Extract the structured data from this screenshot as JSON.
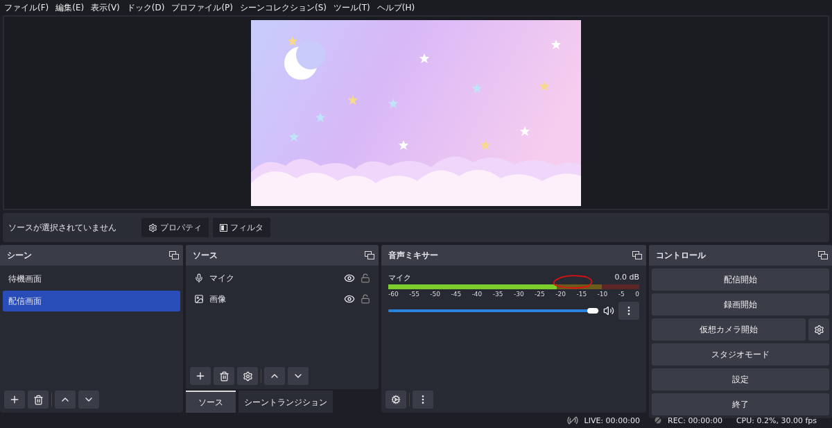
{
  "menu": [
    "ファイル(F)",
    "編集(E)",
    "表示(V)",
    "ドック(D)",
    "プロファイル(P)",
    "シーンコレクション(S)",
    "ツール(T)",
    "ヘルプ(H)"
  ],
  "context_bar": {
    "label": "ソースが選択されていません",
    "buttons": [
      {
        "label": "プロパティ",
        "kind": "gear"
      },
      {
        "label": "フィルタ",
        "kind": "filter"
      }
    ]
  },
  "scenes": {
    "title": "シーン",
    "items": [
      {
        "label": "待機画面",
        "selected": false
      },
      {
        "label": "配信画面",
        "selected": true
      }
    ]
  },
  "sources": {
    "title": "ソース",
    "items": [
      {
        "label": "マイク",
        "kind": "mic",
        "visible": true,
        "locked": false
      },
      {
        "label": "画像",
        "kind": "image",
        "visible": true,
        "locked": false
      }
    ]
  },
  "bottom_tabs": [
    {
      "label": "ソース",
      "selected": true
    },
    {
      "label": "シーントランジション",
      "selected": false
    }
  ],
  "mixer": {
    "title": "音声ミキサー",
    "channels": [
      {
        "name": "マイク",
        "reading": "0.0 dB",
        "meter": {
          "level": 0.67
        },
        "volume": {
          "level": 0.97
        },
        "muted": false
      }
    ],
    "scale": [
      "-60",
      "-55",
      "-50",
      "-45",
      "-40",
      "-35",
      "-30",
      "-25",
      "-20",
      "-15",
      "-10",
      "-5",
      "0"
    ]
  },
  "controls": {
    "title": "コントロール",
    "buttons": [
      {
        "label": "配信開始",
        "kind": "plain"
      },
      {
        "label": "録画開始",
        "kind": "plain"
      },
      {
        "label": "仮想カメラ開始",
        "kind": "with-settings"
      },
      {
        "label": "スタジオモード",
        "kind": "plain"
      },
      {
        "label": "設定",
        "kind": "plain"
      },
      {
        "label": "終了",
        "kind": "plain"
      }
    ]
  },
  "status": {
    "live": "LIVE: 00:00:00",
    "rec": "REC: 00:00:00",
    "cpu": "CPU: 0.2%, 30.00 fps"
  }
}
